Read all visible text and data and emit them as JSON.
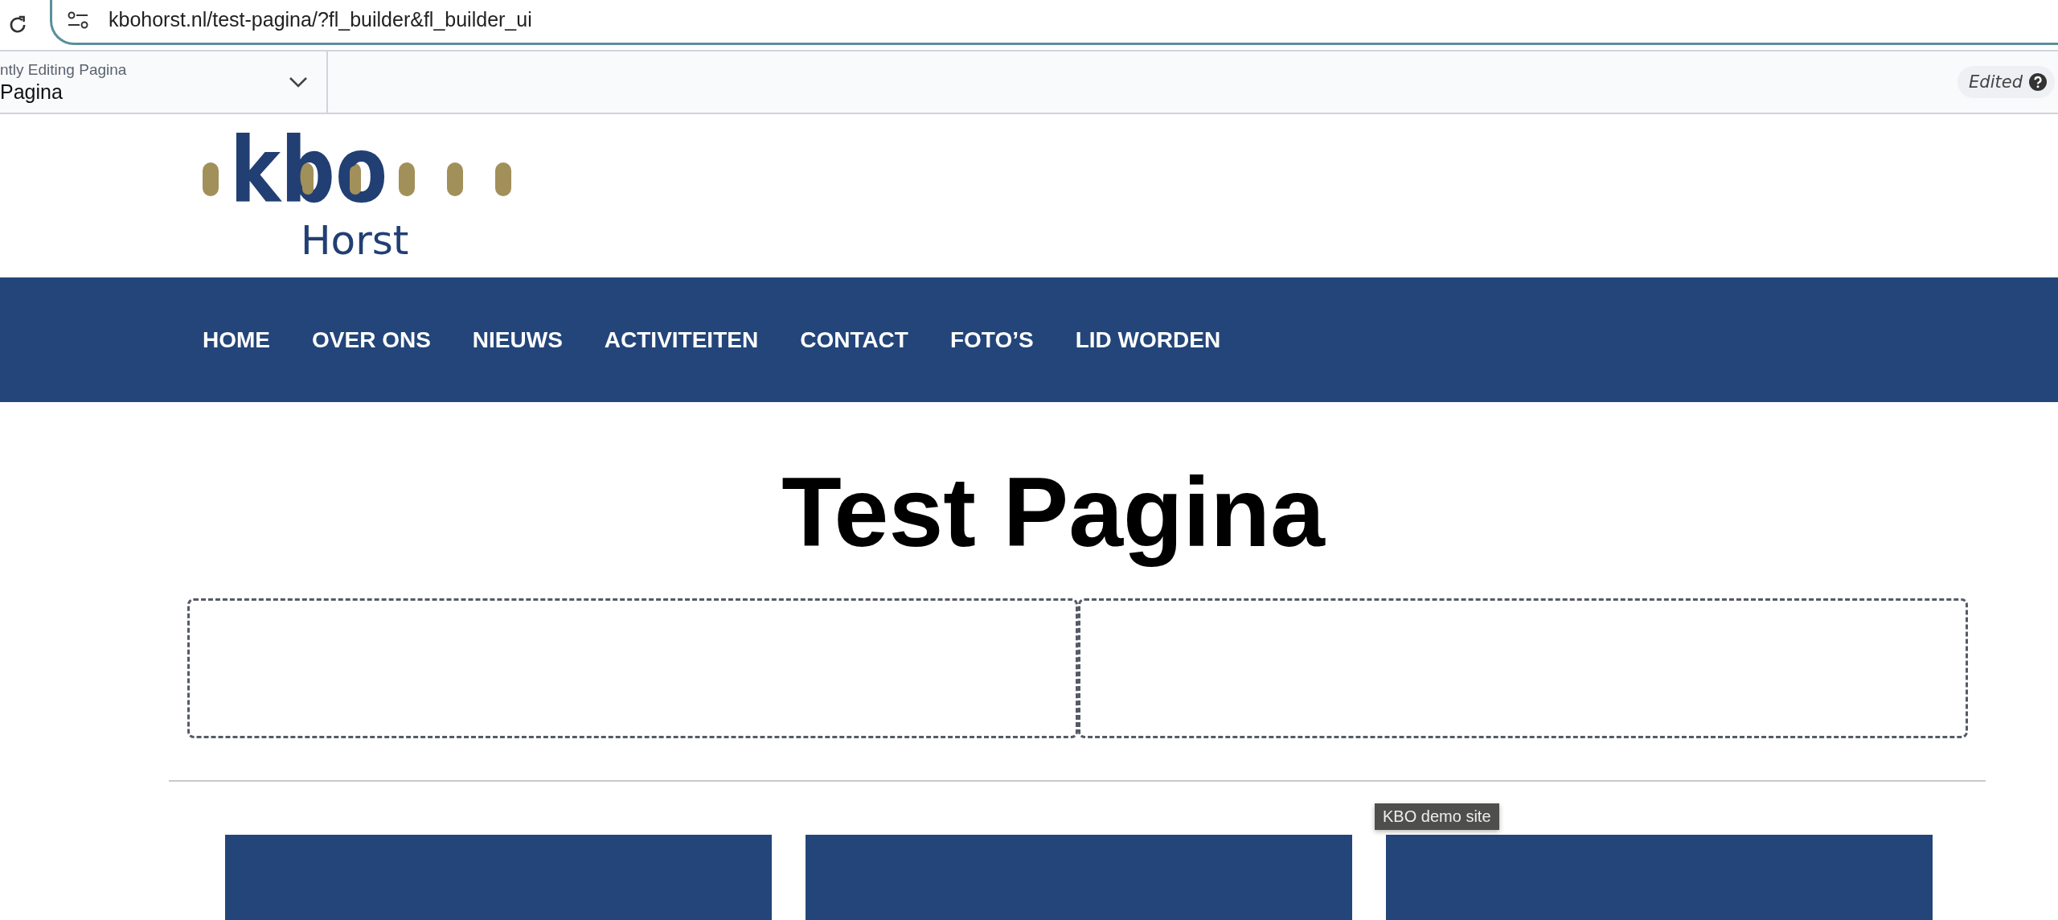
{
  "browser": {
    "url": "kbohorst.nl/test-pagina/?fl_builder&fl_builder_ui"
  },
  "builder_bar": {
    "editing_label": "ntly Editing Pagina",
    "page_name": "Pagina",
    "status": "Edited"
  },
  "logo": {
    "wordmark": "kbo",
    "place": "Horst"
  },
  "nav": {
    "items": [
      "HOME",
      "OVER ONS",
      "NIEUWS",
      "ACTIVITEITEN",
      "CONTACT",
      "FOTO’S",
      "LID WORDEN"
    ]
  },
  "page": {
    "title": "Test Pagina",
    "tooltip": "KBO demo site"
  }
}
